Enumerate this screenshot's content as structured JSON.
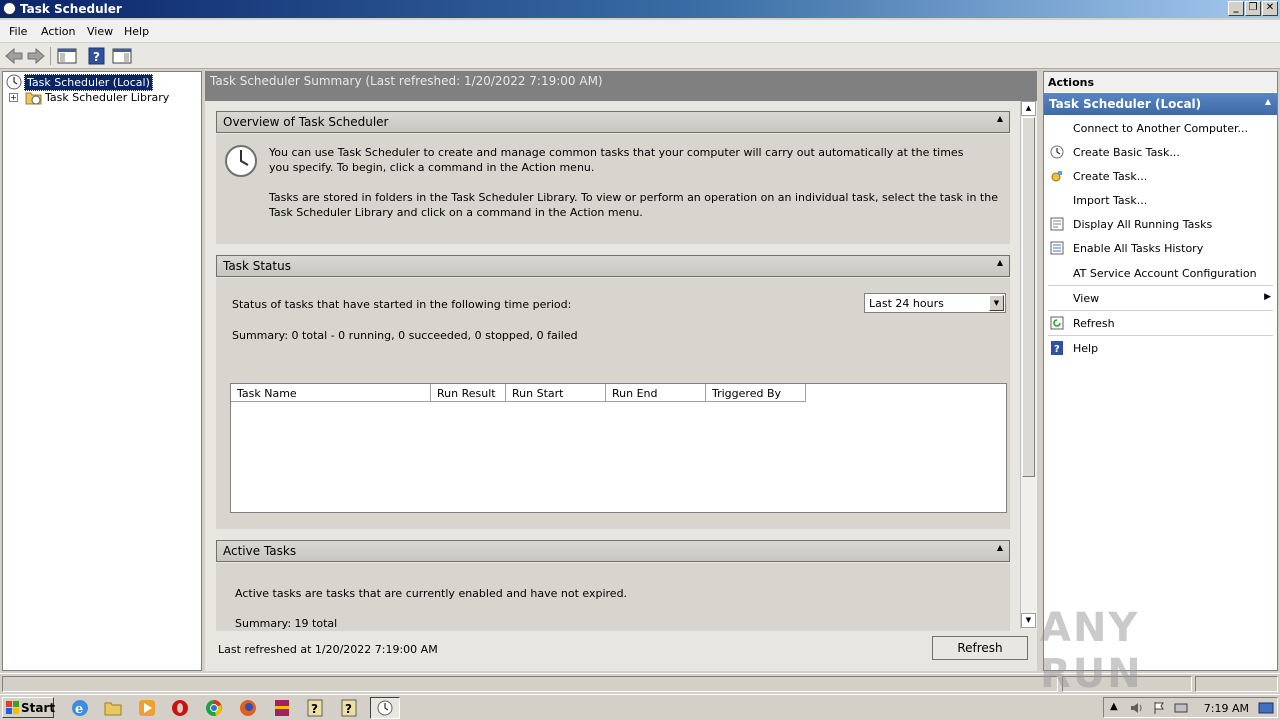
{
  "window": {
    "title": "Task Scheduler"
  },
  "menu": [
    "File",
    "Action",
    "View",
    "Help"
  ],
  "tree": {
    "root": "Task Scheduler (Local)",
    "child": "Task Scheduler Library",
    "expander": "+"
  },
  "center": {
    "header": "Task Scheduler Summary (Last refreshed: 1/20/2022 7:19:00 AM)",
    "overview": {
      "title": "Overview of Task Scheduler",
      "para1": "You can use Task Scheduler to create and manage common tasks that your computer will carry out automatically at the times you specify. To begin, click a command in the Action menu.",
      "para2": "Tasks are stored in folders in the Task Scheduler Library. To view or perform an operation on an individual task, select the task in the Task Scheduler Library and click on a command in the Action menu."
    },
    "status": {
      "title": "Task Status",
      "period_label": "Status of tasks that have started in the following time period:",
      "period_value": "Last 24 hours",
      "summary": "Summary: 0 total - 0 running, 0 succeeded, 0 stopped, 0 failed",
      "columns": [
        "Task Name",
        "Run Result",
        "Run Start",
        "Run End",
        "Triggered By"
      ]
    },
    "active": {
      "title": "Active Tasks",
      "desc": "Active tasks are tasks that are currently enabled and have not expired.",
      "summary": "Summary: 19 total"
    },
    "last_refreshed": "Last refreshed at 1/20/2022 7:19:00 AM",
    "refresh_button": "Refresh"
  },
  "actions": {
    "title": "Actions",
    "group": "Task Scheduler (Local)",
    "items": [
      "Connect to Another Computer...",
      "Create Basic Task...",
      "Create Task...",
      "Import Task...",
      "Display All Running Tasks",
      "Enable All Tasks History",
      "AT Service Account Configuration",
      "View",
      "Refresh",
      "Help"
    ]
  },
  "taskbar": {
    "start": "Start",
    "clock": "7:19 AM"
  },
  "watermark": "ANY RUN"
}
